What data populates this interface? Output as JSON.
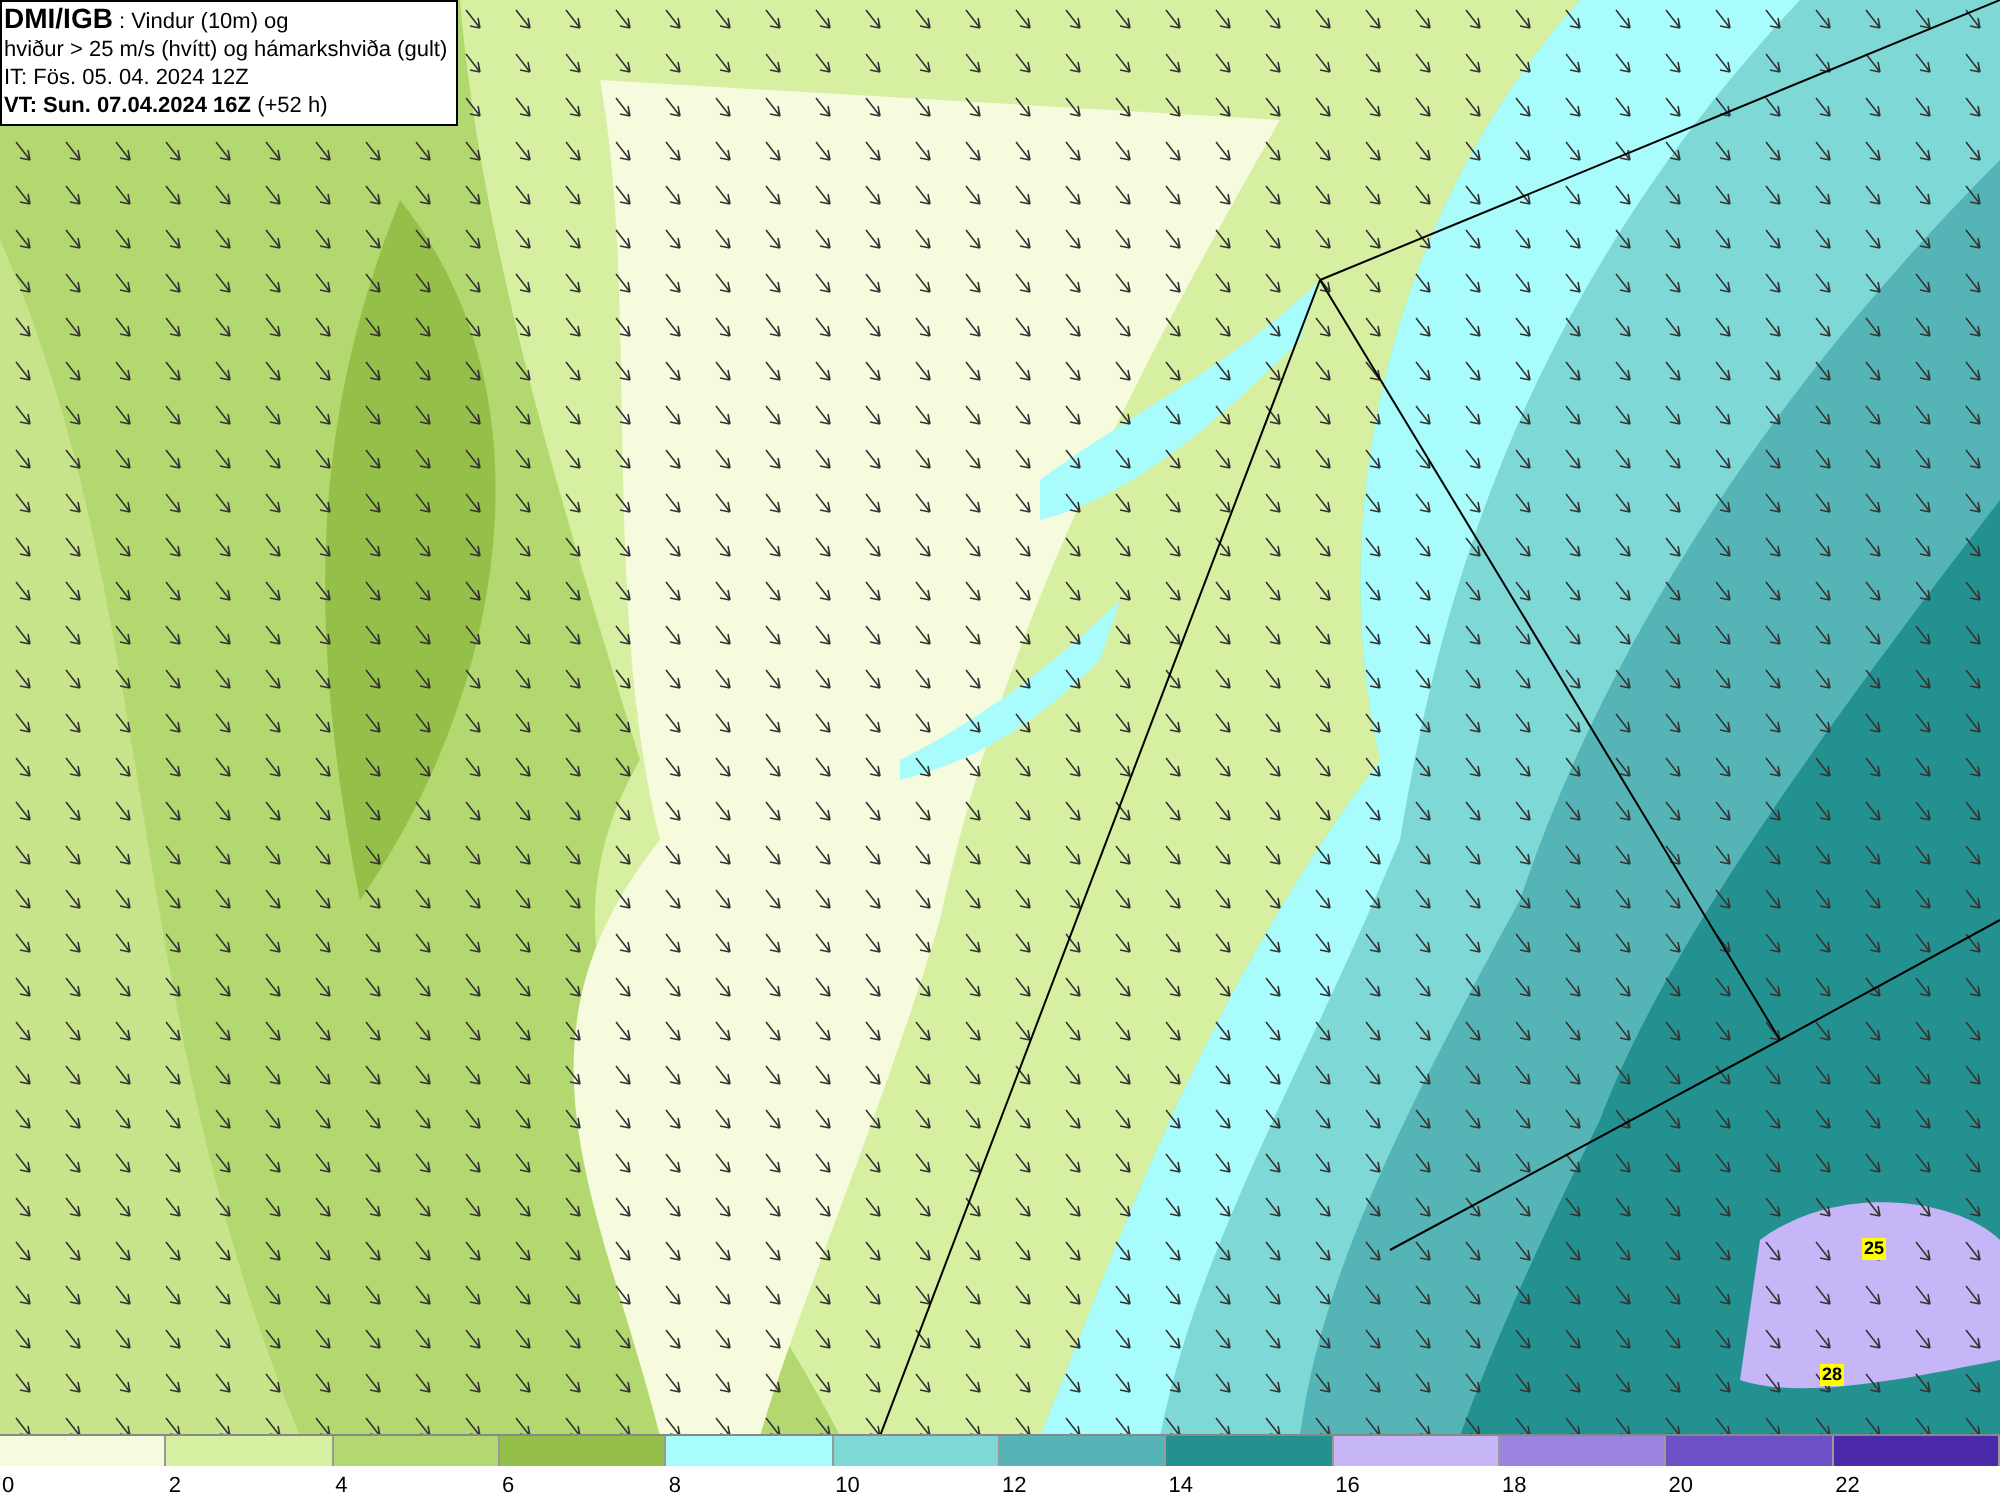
{
  "header": {
    "lines": [
      "**DMI/IGB** : Vindur (10m) og",
      "hviður > 25 m/s (hvítt) og hámarkshviða (gult)",
      "IT: Fös. 05. 04. 2024 12Z",
      "**VT: Sun. 07.04.2024 16Z** (+52 h)"
    ]
  },
  "map": {
    "gust_labels": [
      {
        "text": "25"
      },
      {
        "text": "28"
      }
    ]
  },
  "legend": {
    "bins": [
      {
        "label": "0",
        "color": "#f5fbdc"
      },
      {
        "label": "2",
        "color": "#d6efa0"
      },
      {
        "label": "4",
        "color": "#b4d870"
      },
      {
        "label": "6",
        "color": "#94bf48"
      },
      {
        "label": "8",
        "color": "#a8fcfc"
      },
      {
        "label": "10",
        "color": "#7ed8d6"
      },
      {
        "label": "12",
        "color": "#55b5b6"
      },
      {
        "label": "14",
        "color": "#249191"
      },
      {
        "label": "16",
        "color": "#c6b6f8"
      },
      {
        "label": "18",
        "color": "#9a84e0"
      },
      {
        "label": "20",
        "color": "#6c50c8"
      },
      {
        "label": "22",
        "color": "#4a2aa8"
      }
    ]
  }
}
